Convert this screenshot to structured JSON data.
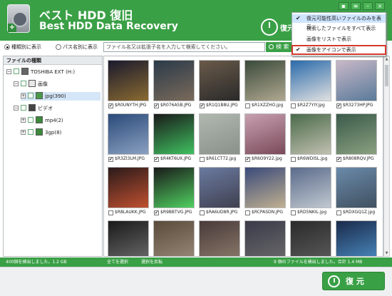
{
  "app": {
    "title_jp": "ベスト HDD 復旧",
    "title_en": "Best HDD Data Recovery",
    "restore_label": "復元"
  },
  "dropdown_menu": [
    {
      "label": "復元可能性高いファイルのみを表示",
      "checked": true
    },
    {
      "label": "検索したファイルをすべて表示",
      "checked": false
    },
    {
      "label": "画像をリストで表示",
      "checked": false
    },
    {
      "label": "画像をアイコンで表示",
      "checked": true
    }
  ],
  "view_options": {
    "by_type": "種類別に表示",
    "by_path": "パス名別に表示"
  },
  "search": {
    "placeholder": "ファイル名又は拡張子名を入力して検索してください。",
    "button": "検 索"
  },
  "tree": {
    "header": "ファイルの種類",
    "nodes": [
      {
        "label": "TOSHIBA EXT (H:)",
        "expander": "−",
        "icon": "hdd-icon"
      },
      {
        "label": "画像",
        "expander": "−",
        "icon": "image-folder-icon"
      },
      {
        "label": "jpg(390)",
        "expander": "+",
        "icon": "jpg-file-icon"
      },
      {
        "label": "ビデオ",
        "expander": "−",
        "icon": "video-folder-icon"
      },
      {
        "label": "mp4(2)",
        "expander": "+",
        "icon": "mp4-file-icon"
      },
      {
        "label": "3gp(8)",
        "expander": "+",
        "icon": "3gp-file-icon"
      }
    ]
  },
  "files": [
    {
      "name": "$R0UNYTH.JPG",
      "checked": true,
      "colors": [
        "#1a1a2e",
        "#8a6a30"
      ]
    },
    {
      "name": "$R076A5B.JPG",
      "checked": true,
      "colors": [
        "#2a3a4a",
        "#7a6a5a"
      ]
    },
    {
      "name": "$R1Q1B8U.JPG",
      "checked": true,
      "colors": [
        "#6a5a4a",
        "#2a2a2a"
      ]
    },
    {
      "name": "$R1XZZHO.jpg",
      "checked": false,
      "colors": [
        "#3a4a3a",
        "#b0a890"
      ]
    },
    {
      "name": "$R2Z7YIY.jpg",
      "checked": false,
      "colors": [
        "#2a6aaa",
        "#e0e0e0"
      ]
    },
    {
      "name": "$R3273HP.JPG",
      "checked": true,
      "colors": [
        "#c8b8c8",
        "#5a7a9a"
      ]
    },
    {
      "name": "$R3ZI3LM.JPG",
      "checked": true,
      "colors": [
        "#2a4a7a",
        "#8aa0c0"
      ]
    },
    {
      "name": "$R4KT6UX.JPG",
      "checked": true,
      "colors": [
        "#1a1a1a",
        "#40c060"
      ]
    },
    {
      "name": "$R61CT72.jpg",
      "checked": false,
      "colors": [
        "#b0b8b0",
        "#8a908a"
      ]
    },
    {
      "name": "$R6O9Y22.jpg",
      "checked": true,
      "colors": [
        "#c8a0b0",
        "#7a4a5a"
      ]
    },
    {
      "name": "$R6WDISL.jpg",
      "checked": false,
      "colors": [
        "#4a6a4a",
        "#c0c0b0"
      ]
    },
    {
      "name": "$R808RQV.JPG",
      "checked": true,
      "colors": [
        "#3a5a4a",
        "#8aa080"
      ]
    },
    {
      "name": "$R8LAUKK.JPG",
      "checked": false,
      "colors": [
        "#2a1a1a",
        "#c05030"
      ]
    },
    {
      "name": "$R9BBTVG.JPG",
      "checked": true,
      "colors": [
        "#1a1a1a",
        "#50d060"
      ]
    },
    {
      "name": "$RA6UD8R.JPG",
      "checked": false,
      "colors": [
        "#6a7aa0",
        "#404050"
      ]
    },
    {
      "name": "$RCPASDN.JPG",
      "checked": false,
      "colors": [
        "#3a4a7a",
        "#c0b090"
      ]
    },
    {
      "name": "$RD5NKIL.jpg",
      "checked": false,
      "colors": [
        "#5a6a8a",
        "#c0c8d0"
      ]
    },
    {
      "name": "$RDXGQ1Z.jpg",
      "checked": false,
      "colors": [
        "#6a8aaa",
        "#405060"
      ]
    },
    {
      "name": "",
      "checked": false,
      "colors": [
        "#1a1a1a",
        "#6a6a6a"
      ]
    },
    {
      "name": "",
      "checked": false,
      "colors": [
        "#5a4a3a",
        "#9a8a7a"
      ]
    },
    {
      "name": "",
      "checked": false,
      "colors": [
        "#4a3a3a",
        "#8a7a6a"
      ]
    },
    {
      "name": "",
      "checked": false,
      "colors": [
        "#3a3a4a",
        "#6a6a6a"
      ]
    },
    {
      "name": "",
      "checked": false,
      "colors": [
        "#2a2a2a",
        "#5a5a5a"
      ]
    },
    {
      "name": "",
      "checked": false,
      "colors": [
        "#1a2a4a",
        "#4a8ac0"
      ]
    }
  ],
  "status": {
    "found": "400個を検出しました。1.2 GB",
    "select_all": "全てを選択",
    "invert": "選択を反転",
    "selected": "9 個のファイルを検出しました。合計 1.4 MB"
  },
  "footer": {
    "restore_button": "復 元"
  },
  "colors": {
    "brand_green": "#3aa046",
    "menu_highlight": "#cfe5ff",
    "callout_red": "#d43a2e"
  }
}
